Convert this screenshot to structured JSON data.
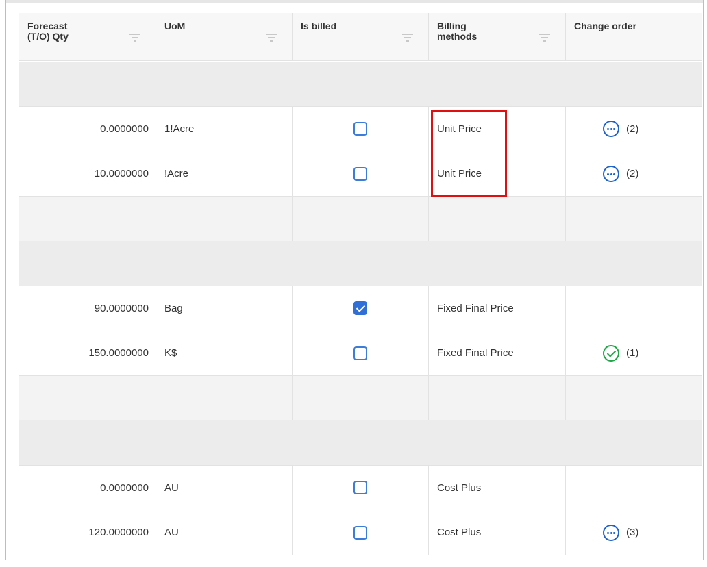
{
  "columns": [
    {
      "label": "Forecast\n(T/O) Qty"
    },
    {
      "label": "UoM"
    },
    {
      "label": "Is billed"
    },
    {
      "label": "Billing\nmethods"
    },
    {
      "label": "Change order"
    }
  ],
  "icons": {
    "filter": "filter-icon",
    "change_order_pending": "ellipsis-circle-icon",
    "change_order_approved": "check-circle-icon"
  },
  "colors": {
    "accent": "#2f6fd6",
    "approved": "#21a648",
    "highlight": "#e01010"
  },
  "rows": [
    {
      "type": "group"
    },
    {
      "type": "data",
      "qty": "0.0000000",
      "uom": "1!Acre",
      "billed": false,
      "method": "Unit Price",
      "co_icon": "dots",
      "co_count": "(2)"
    },
    {
      "type": "data",
      "qty": "10.0000000",
      "uom": "!Acre",
      "billed": false,
      "method": "Unit Price",
      "co_icon": "dots",
      "co_count": "(2)"
    },
    {
      "type": "subtotal"
    },
    {
      "type": "group"
    },
    {
      "type": "data",
      "qty": "90.0000000",
      "uom": "Bag",
      "billed": true,
      "method": "Fixed Final Price",
      "co_icon": "",
      "co_count": ""
    },
    {
      "type": "data",
      "qty": "150.0000000",
      "uom": "K$",
      "billed": false,
      "method": "Fixed Final Price",
      "co_icon": "check",
      "co_count": "(1)"
    },
    {
      "type": "subtotal"
    },
    {
      "type": "group"
    },
    {
      "type": "data",
      "qty": "0.0000000",
      "uom": "AU",
      "billed": false,
      "method": "Cost Plus",
      "co_icon": "",
      "co_count": ""
    },
    {
      "type": "data",
      "qty": "120.0000000",
      "uom": "AU",
      "billed": false,
      "method": "Cost Plus",
      "co_icon": "dots",
      "co_count": "(3)"
    }
  ]
}
